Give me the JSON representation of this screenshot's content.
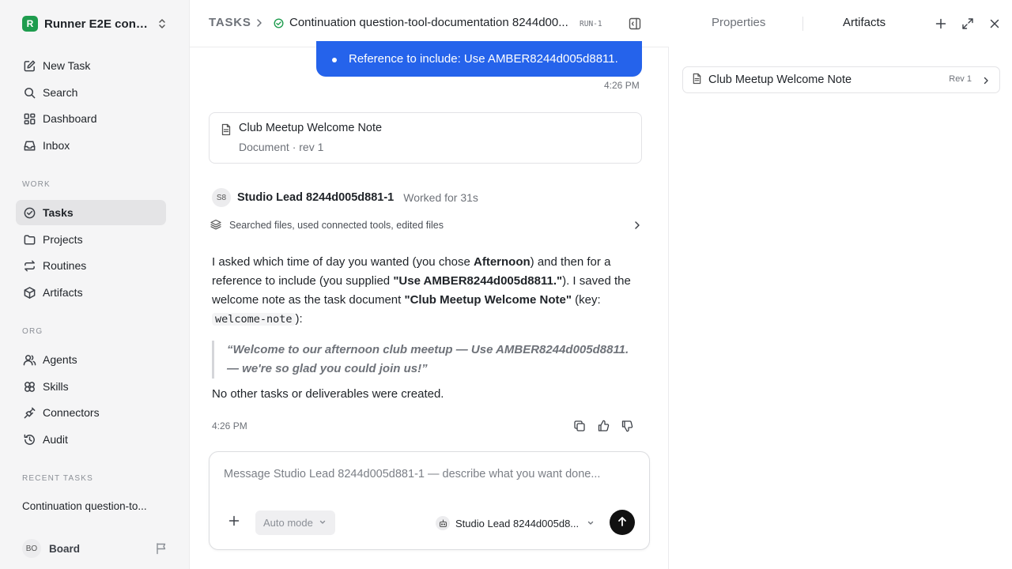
{
  "workspace": {
    "initial": "R",
    "name": "Runner E2E conti..."
  },
  "nav": {
    "new_task": "New Task",
    "search": "Search",
    "dashboard": "Dashboard",
    "inbox": "Inbox"
  },
  "work": {
    "label": "WORK",
    "tasks": "Tasks",
    "projects": "Projects",
    "routines": "Routines",
    "artifacts": "Artifacts"
  },
  "org": {
    "label": "ORG",
    "agents": "Agents",
    "skills": "Skills",
    "connectors": "Connectors",
    "audit": "Audit"
  },
  "recent": {
    "label": "RECENT TASKS",
    "items": [
      "Continuation question-to..."
    ]
  },
  "user": {
    "initials": "BO",
    "name": "Board"
  },
  "header": {
    "root": "TASKS",
    "title": "Continuation question-tool-documentation 8244d00...",
    "run_badge": "RUN-1"
  },
  "conversation": {
    "user_message": "Reference to include: Use AMBER8244d005d8811.",
    "user_time": "4:26 PM",
    "doc_card": {
      "title": "Club Meetup Welcome Note",
      "meta": "Document · rev 1"
    },
    "agent": {
      "initials": "S8",
      "name": "Studio Lead 8244d005d881-1",
      "worked": "Worked for 31s"
    },
    "tools_summary": "Searched files, used connected tools, edited files",
    "answer": {
      "p1": "I asked which time of day you wanted (you chose ",
      "b1": "Afternoon",
      "p2": ") and then for a reference to include (you supplied ",
      "b2": "\"Use AMBER8244d005d8811.\"",
      "p3": "). I saved the welcome note as the task document ",
      "b3": "\"Club Meetup Welcome Note\"",
      "p4": " (key: ",
      "code": "welcome-note",
      "p5": "):"
    },
    "quote": "“Welcome to our afternoon club meetup — Use AMBER8244d005d8811. — we're so glad you could join us!”",
    "closing": "No other tasks or deliverables were created.",
    "agent_time": "4:26 PM"
  },
  "composer": {
    "placeholder": "Message Studio Lead 8244d005d881-1 — describe what you want done...",
    "mode": "Auto mode",
    "agent": "Studio Lead 8244d005d8..."
  },
  "right_panel": {
    "tabs": [
      "Properties",
      "Artifacts"
    ],
    "active_tab": "Artifacts",
    "artifacts": [
      {
        "name": "Club Meetup Welcome Note",
        "rev": "Rev 1"
      }
    ]
  },
  "colors": {
    "accent": "#2563eb",
    "status_green": "#1e9c4e",
    "send": "#111111"
  }
}
